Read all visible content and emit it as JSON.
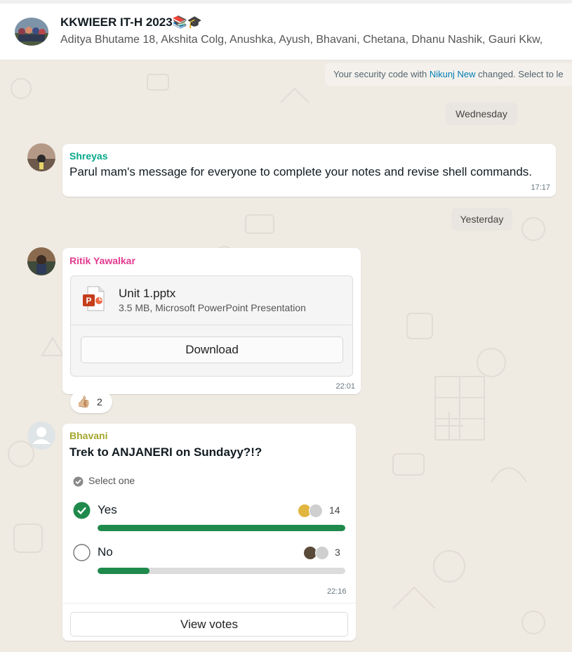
{
  "header": {
    "title": "KKWIEER IT-H 2023📚🎓",
    "members": "Aditya Bhutame 18, Akshita Colg, Anushka, Ayush, Bhavani, Chetana, Dhanu Nashik, Gauri Kkw,"
  },
  "system_message": {
    "prefix": "Your security code with ",
    "contact": "Nikunj New",
    "suffix": " changed. Select to le"
  },
  "dates": {
    "first": "Wednesday",
    "second": "Yesterday"
  },
  "messages": {
    "shreyas": {
      "sender": "Shreyas",
      "text": "Parul mam's message for everyone to complete your notes and revise shell commands.",
      "time": "17:17"
    },
    "ritik": {
      "sender": "Ritik Yawalkar",
      "file_name": "Unit 1.pptx",
      "file_meta": "3.5 MB, Microsoft PowerPoint Presentation",
      "download_label": "Download",
      "time": "22:01",
      "reaction_emoji": "👍🏼",
      "reaction_count": "2"
    },
    "bhavani": {
      "sender": "Bhavani",
      "question": "Trek to ANJANERI on Sundayy?!?",
      "select_hint": "Select one",
      "options": [
        {
          "label": "Yes",
          "count": "14",
          "selected": true,
          "fill": 1.0
        },
        {
          "label": "No",
          "count": "3",
          "selected": false,
          "fill": 0.21
        }
      ],
      "time": "22:16",
      "view_votes_label": "View votes"
    }
  },
  "colors": {
    "shreyas_name": "#06a88a",
    "ritik_name": "#e23a8f",
    "bhavani_name": "#a4a62d",
    "poll_green": "#1f8a4c",
    "link_blue": "#027eb5",
    "chat_bg": "#efeae2"
  },
  "icons": {
    "file": "powerpoint-file-icon",
    "check": "check-circle-icon",
    "radio": "radio-empty-icon",
    "select": "select-one-icon",
    "avatar_placeholder": "person-placeholder-icon"
  }
}
